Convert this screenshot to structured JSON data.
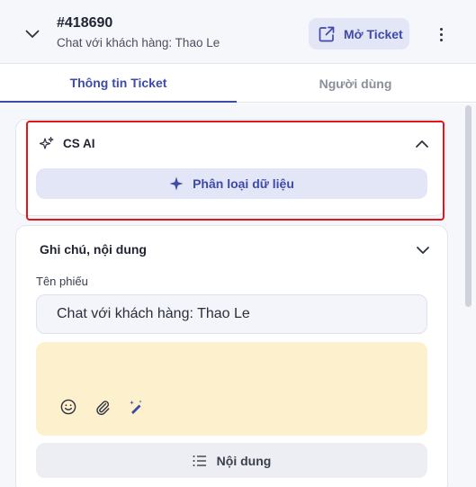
{
  "header": {
    "ticket_id": "#418690",
    "subtitle": "Chat với khách hàng: Thao Le",
    "open_ticket_label": "Mở Ticket"
  },
  "tabs": [
    {
      "label": "Thông tin Ticket",
      "active": true
    },
    {
      "label": "Người dùng",
      "active": false
    }
  ],
  "ai_section": {
    "title": "CS AI",
    "classify_label": "Phân loại dữ liệu"
  },
  "notes_section": {
    "title": "Ghi chú, nội dung",
    "name_label": "Tên phiếu",
    "name_value": "Chat với khách hàng: Thao Le",
    "content_label": "Nội dung",
    "tools": [
      "emoji-icon",
      "paperclip-icon",
      "magic-pen-icon"
    ]
  },
  "colors": {
    "accent": "#3e4aa8",
    "accent_bg": "#e3e6f7",
    "note_bg": "#fdf0cc",
    "highlight": "#e0161b"
  }
}
